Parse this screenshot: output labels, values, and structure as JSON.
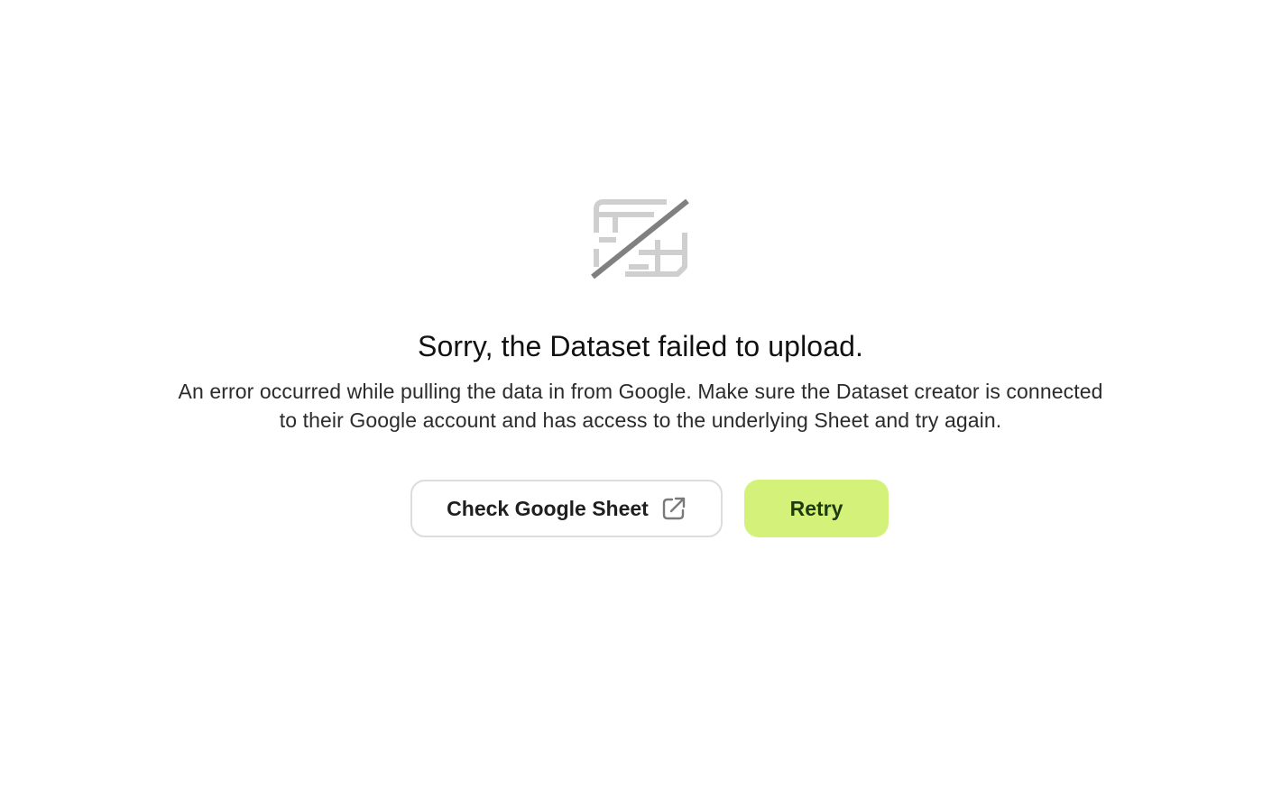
{
  "error": {
    "title": "Sorry, the Dataset failed to upload.",
    "description": "An error occurred while pulling the data in from Google. Make sure the Dataset creator is connected to their Google account and has access to the underlying Sheet and try again.",
    "illustration_icon": "broken-table-icon"
  },
  "actions": {
    "check_sheet_label": "Check Google Sheet",
    "check_sheet_icon": "external-link-icon",
    "retry_label": "Retry"
  },
  "colors": {
    "retry_background": "#d4f27a",
    "retry_text": "#1e3a12",
    "secondary_border": "#dcdcdc",
    "illustration_light": "#cfcfcf",
    "illustration_slash": "#808080"
  }
}
